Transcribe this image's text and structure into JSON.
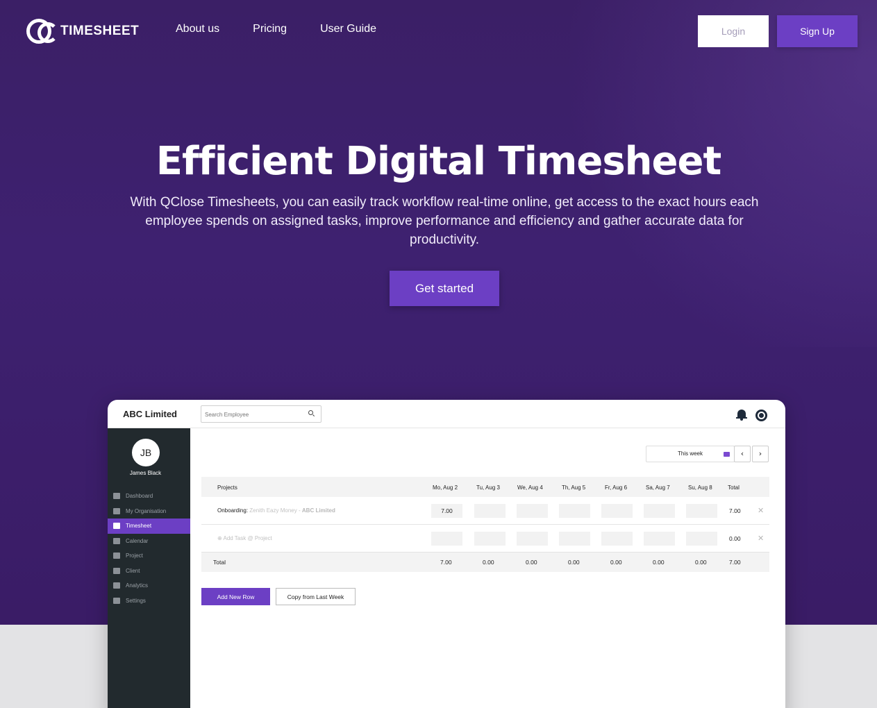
{
  "nav": {
    "logo_text": "TIMESHEET",
    "links": [
      "About us",
      "Pricing",
      "User Guide"
    ],
    "login": "Login",
    "signup": "Sign Up"
  },
  "hero": {
    "title": "Efficient Digital Timesheet",
    "subtitle": "With QClose Timesheets, you can easily track workflow real-time online, get access to the exact hours each employee spends on assigned tasks, improve performance and efficiency and gather accurate data for productivity.",
    "cta": "Get started"
  },
  "app": {
    "company": "ABC Limited",
    "search_placeholder": "Search Employee",
    "user_initials": "JB",
    "user_name": "James Black",
    "menu": [
      "Dashboard",
      "My Organisation",
      "Timesheet",
      "Calendar",
      "Project",
      "Client",
      "Analytics",
      "Settings"
    ],
    "week_label": "This week",
    "table": {
      "headers": [
        "Projects",
        "Mo, Aug 2",
        "Tu, Aug 3",
        "We, Aug 4",
        "Th, Aug 5",
        "Fr, Aug 6",
        "Sa, Aug 7",
        "Su, Aug 8",
        "Total"
      ],
      "row1": {
        "project": "Onboarding",
        "subproject": "Zenith Eazy Money",
        "separator": "-",
        "client": "ABC Limited",
        "values": [
          "7.00",
          "",
          "",
          "",
          "",
          "",
          ""
        ],
        "total": "7.00"
      },
      "row2": {
        "add_task": "Add Task @ Project",
        "values": [
          "",
          "",
          "",
          "",
          "",
          "",
          ""
        ],
        "total": "0.00"
      },
      "totals": {
        "label": "Total",
        "values": [
          "7.00",
          "0.00",
          "0.00",
          "0.00",
          "0.00",
          "0.00",
          "0.00"
        ],
        "total": "7.00"
      }
    },
    "add_row": "Add New Row",
    "copy_week": "Copy from Last Week"
  },
  "colors": {
    "hero_bg": "#3d2070",
    "accent": "#6c3fc4",
    "sidebar_bg": "#222a2e"
  }
}
